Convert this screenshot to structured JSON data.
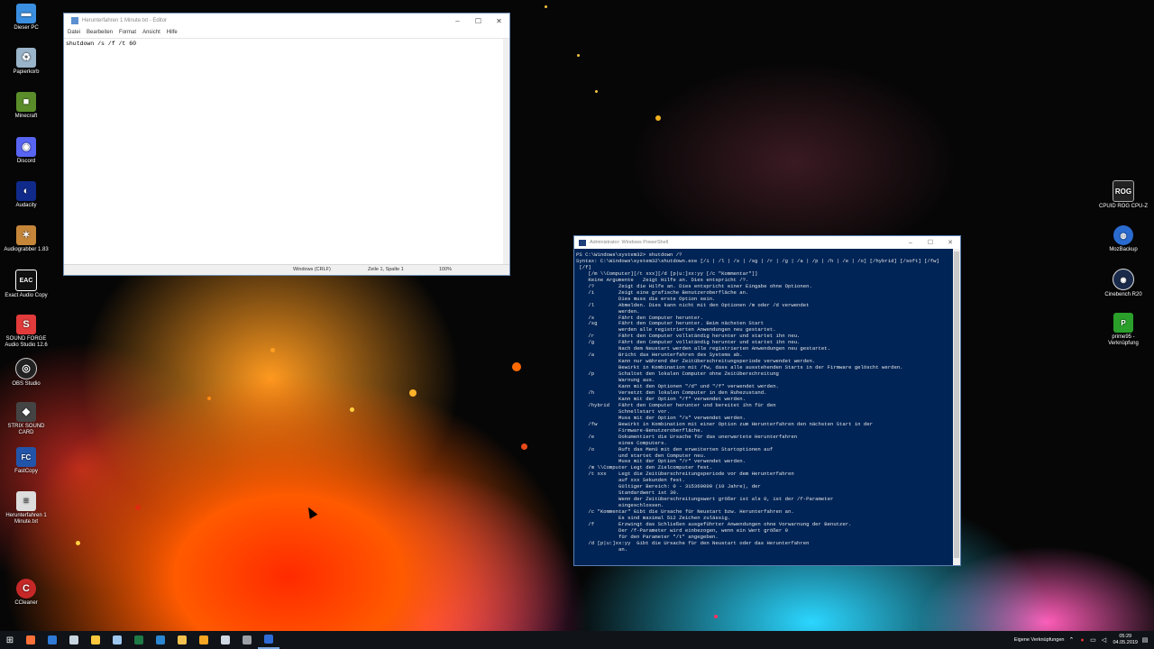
{
  "desktop_icons": [
    {
      "label": "Dieser PC",
      "icon": "computer-icon",
      "color": "#3b8fe0",
      "glyph": "▬"
    },
    {
      "label": "Papierkorb",
      "icon": "recycle-bin-icon",
      "color": "#9ab4c9",
      "glyph": "♻"
    },
    {
      "label": "Minecraft",
      "icon": "minecraft-icon",
      "color": "#5a8d2a",
      "glyph": "■"
    },
    {
      "label": "Discord",
      "icon": "discord-icon",
      "color": "#5865f2",
      "glyph": "◉"
    },
    {
      "label": "Audacity",
      "icon": "audacity-icon",
      "color": "#0f2a8a",
      "glyph": "◐"
    },
    {
      "label": "Audiograbber 1.83",
      "icon": "audiograbber-icon",
      "color": "#c5863a",
      "glyph": "✶"
    },
    {
      "label": "Exact Audio Copy",
      "icon": "eac-icon",
      "color": "#111111",
      "glyph": "EAC"
    },
    {
      "label": "SOUND FORGE Audio Studio 12.6",
      "icon": "soundforge-icon",
      "color": "#e23b3b",
      "glyph": "S"
    },
    {
      "label": "OBS Studio",
      "icon": "obs-icon",
      "color": "#222222",
      "glyph": "◎"
    },
    {
      "label": "STRIX SOUND CARD",
      "icon": "strix-icon",
      "color": "#444444",
      "glyph": "◆"
    },
    {
      "label": "FastCopy",
      "icon": "fastcopy-icon",
      "color": "#2255aa",
      "glyph": "FC"
    },
    {
      "label": "Herunterfahren 1 Minute.txt",
      "icon": "text-file-icon",
      "color": "#dddddd",
      "glyph": "≡"
    },
    {
      "label": "CCleaner",
      "icon": "ccleaner-icon",
      "color": "#c62828",
      "glyph": "C"
    }
  ],
  "desktop_icons_right": [
    {
      "label": "CPUID ROG CPU-Z",
      "icon": "cpuz-icon",
      "color": "#222222",
      "glyph": "ROG"
    },
    {
      "label": "MozBackup",
      "icon": "mozbackup-icon",
      "color": "#2a6bd0",
      "glyph": "◍"
    },
    {
      "label": "Cinebench R20",
      "icon": "cinebench-icon",
      "color": "#1a2a4a",
      "glyph": "◉"
    },
    {
      "label": "prime95 - Verknüpfung",
      "icon": "prime95-icon",
      "color": "#2aa02a",
      "glyph": "P"
    }
  ],
  "notepad": {
    "title": "Herunterfahren 1 Minute.txt - Editor",
    "menu": [
      "Datei",
      "Bearbeiten",
      "Format",
      "Ansicht",
      "Hilfe"
    ],
    "content": "shutdown /s /f /t 60",
    "status": {
      "encoding": "Windows (CRLF)",
      "position": "Zeile 1, Spalte 1",
      "zoom": "100%"
    }
  },
  "powershell": {
    "title": "Administrator: Windows PowerShell",
    "lines": [
      "PS C:\\Windows\\system32> shutdown /?",
      "Syntax: C:\\Windows\\system32\\shutdown.exe [/i | /l | /s | /sg | /r | /g | /a | /p | /h | /e | /o] [/hybrid] [/soft] [/fw]",
      " [/f]",
      "    [/m \\\\Computer][/t xxx][/d [p|u:]xx:yy [/c \"Kommentar\"]]",
      "",
      "    Keine Argumente   Zeigt Hilfe an. Dies entspricht /?.",
      "    /?        Zeigt die Hilfe an. Dies entspricht einer Eingabe ohne Optionen.",
      "    /i        Zeigt eine grafische Benutzeroberfläche an.",
      "              Dies muss die erste Option sein.",
      "    /l        Abmelden. Dies kann nicht mit den Optionen /m oder /d verwendet",
      "              werden.",
      "    /s        Fährt den Computer herunter.",
      "    /sg       Fährt den Computer herunter. Beim nächsten Start",
      "              werden alle registrierten Anwendungen neu gestartet.",
      "    /r        Fährt den Computer vollständig herunter und startet ihn neu.",
      "    /g        Fährt den Computer vollständig herunter und startet ihn neu.",
      "              Nach dem Neustart werden alle registrierten Anwendungen neu gestartet.",
      "    /a        Bricht das Herunterfahren des Systems ab.",
      "              Kann nur während der Zeitüberschreitungsperiode verwendet werden.",
      "              Bewirkt in Kombination mit /fw, dass alle ausstehenden Starts in der Firmware gelöscht werden.",
      "    /p        Schaltet den lokalen Computer ohne Zeitüberschreitung",
      "              Warnung aus.",
      "              Kann mit den Optionen \"/d\" und \"/f\" verwendet werden.",
      "    /h        Versetzt den lokalen Computer in den Ruhezustand.",
      "              Kann mit der Option \"/f\" verwendet werden.",
      "    /hybrid   Fährt den Computer herunter und bereitet ihn für den",
      "              Schnellstart vor.",
      "              Muss mit der Option \"/s\" verwendet werden.",
      "    /fw       Bewirkt in Kombination mit einer Option zum Herunterfahren den nächsten Start in der",
      "              Firmware-Benutzeroberfläche.",
      "    /e        Dokumentiert die Ursache für das unerwartete Herunterfahren",
      "              eines Computers.",
      "    /o        Ruft das Menü mit den erweiterten Startoptionen auf",
      "              und startet den Computer neu.",
      "              Muss mit der Option \"/r\" verwendet werden.",
      "    /m \\\\Computer Legt den Zielcomputer fest.",
      "    /t xxx    Legt die Zeitüberschreitungsperiode vor dem Herunterfahren",
      "              auf xxx Sekunden fest.",
      "              Gültiger Bereich: 0 - 315360000 (10 Jahre), der",
      "              Standardwert ist 30.",
      "              Wenn der Zeitüberschreitungswert größer ist als 0, ist der /f-Parameter",
      "              eingeschlossen.",
      "    /c \"Kommentar\" Gibt die Ursache für Neustart bzw. Herunterfahren an.",
      "              Es sind maximal 512 Zeichen zulässig.",
      "    /f        Erzwingt das Schließen ausgeführter Anwendungen ohne Vorwarnung der Benutzer.",
      "              Der /f-Parameter wird einbezogen, wenn ein Wert größer 0",
      "              für den Parameter \"/t\" angegeben.",
      "    /d [p|u:]xx:yy  Gibt die Ursache für den Neustart oder das Herunterfahren",
      "              an."
    ]
  },
  "taskbar": {
    "items": [
      {
        "icon": "start-icon",
        "color": "#ffffff"
      },
      {
        "icon": "firefox-icon",
        "color": "#ff7139"
      },
      {
        "icon": "mail-icon",
        "color": "#2f7ad6"
      },
      {
        "icon": "steam-icon",
        "color": "#c7d5e0"
      },
      {
        "icon": "file-explorer-icon",
        "color": "#ffc83d"
      },
      {
        "icon": "task-manager-icon",
        "color": "#9ec7ee"
      },
      {
        "icon": "excel-icon",
        "color": "#1d7a45"
      },
      {
        "icon": "edge-icon",
        "color": "#2b87d1"
      },
      {
        "icon": "folder-icon",
        "color": "#f2c14e"
      },
      {
        "icon": "audacity-taskbar-icon",
        "color": "#f5a623"
      },
      {
        "icon": "notepad-taskbar-icon",
        "color": "#cfd8e3"
      },
      {
        "icon": "obs-taskbar-icon",
        "color": "#9aa0a6"
      },
      {
        "icon": "powershell-taskbar-icon",
        "color": "#2f6bd6"
      }
    ],
    "tray_label": "Eigene Verknüpfungen",
    "time": "05:29",
    "date": "04.05.2019"
  }
}
